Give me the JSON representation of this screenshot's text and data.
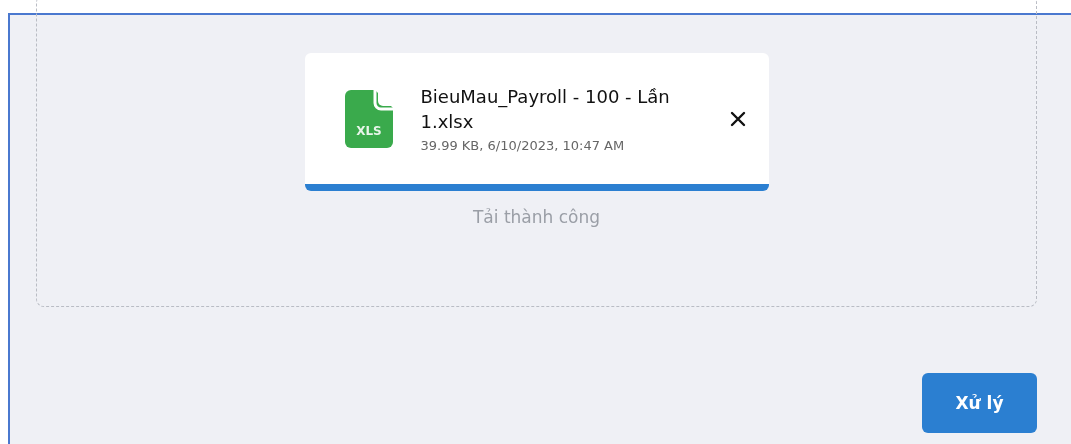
{
  "upload": {
    "file_name": "BieuMau_Payroll - 100 - Lần 1.xlsx",
    "file_type": "XLS",
    "details": "39.99 KB, 6/10/2023, 10:47 AM",
    "level": 1,
    "status": "Tải thành công"
  },
  "process_button": "Xử lý"
}
